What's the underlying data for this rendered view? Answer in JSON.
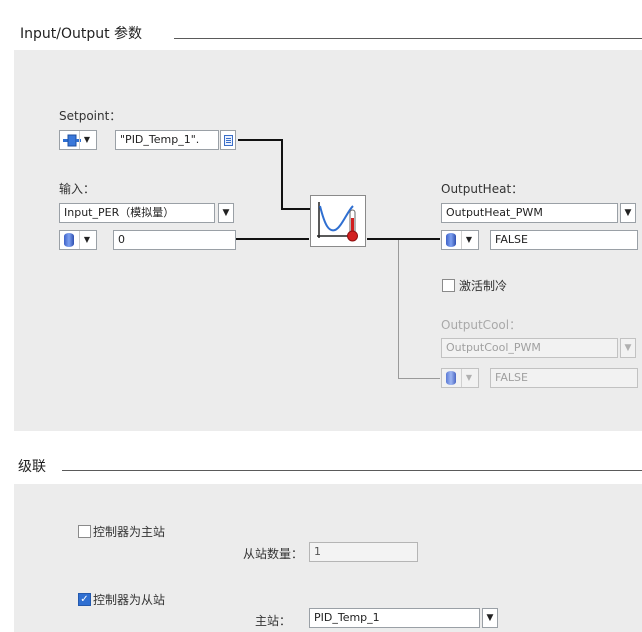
{
  "io": {
    "title": "Input/Output 参数",
    "setpoint_label": "Setpoint：",
    "setpoint_value": "\"PID_Temp_1\".",
    "input_label": "输入：",
    "input_select": "Input_PER（模拟量）",
    "input_value": "0",
    "output_heat_label": "OutputHeat：",
    "output_heat_select": "OutputHeat_PWM",
    "output_heat_value": "FALSE",
    "activate_cooling_label": "激活制冷",
    "activate_cooling_checked": false,
    "output_cool_label": "OutputCool：",
    "output_cool_select": "OutputCool_PWM",
    "output_cool_value": "FALSE"
  },
  "cascade": {
    "title": "级联",
    "master_label": "控制器为主站",
    "master_checked": false,
    "slave_count_label": "从站数量：",
    "slave_count_value": "1",
    "slave_label": "控制器为从站",
    "slave_checked": true,
    "master_station_label": "主站：",
    "master_station_value": "PID_Temp_1"
  },
  "icons": {
    "dropdown": "▼",
    "check": "✓",
    "controller_block": "pid-temperature-controller-icon",
    "db_cylinder": "data-block-icon",
    "instance": "instance-connector-icon"
  },
  "colors": {
    "panel": "#ececec",
    "accent_blue": "#2f6fd1",
    "thermo_red": "#d21f1f"
  }
}
